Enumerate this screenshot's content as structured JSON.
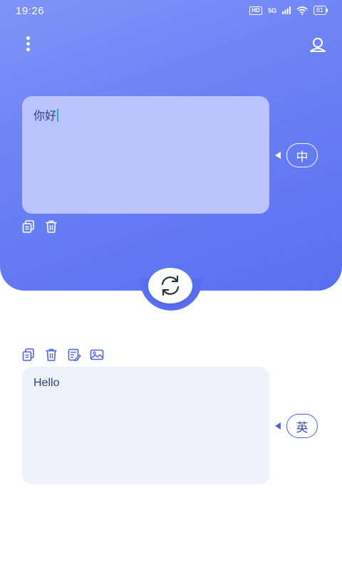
{
  "status_bar": {
    "time": "19:26",
    "hd": "HD",
    "network": "5G",
    "battery": "81"
  },
  "header": {
    "menu_icon": "more-vertical-icon",
    "profile_icon": "user-icon"
  },
  "source": {
    "text": "你好",
    "language": "中"
  },
  "target": {
    "text": "Hello",
    "language": "英"
  },
  "colors": {
    "panel_gradient_start": "#7f94f8",
    "panel_gradient_end": "#5a6ff0",
    "source_box": "#bac3fb",
    "target_box": "#eef0fa",
    "accent": "#4f62d8",
    "cursor": "#1fb7a6"
  }
}
